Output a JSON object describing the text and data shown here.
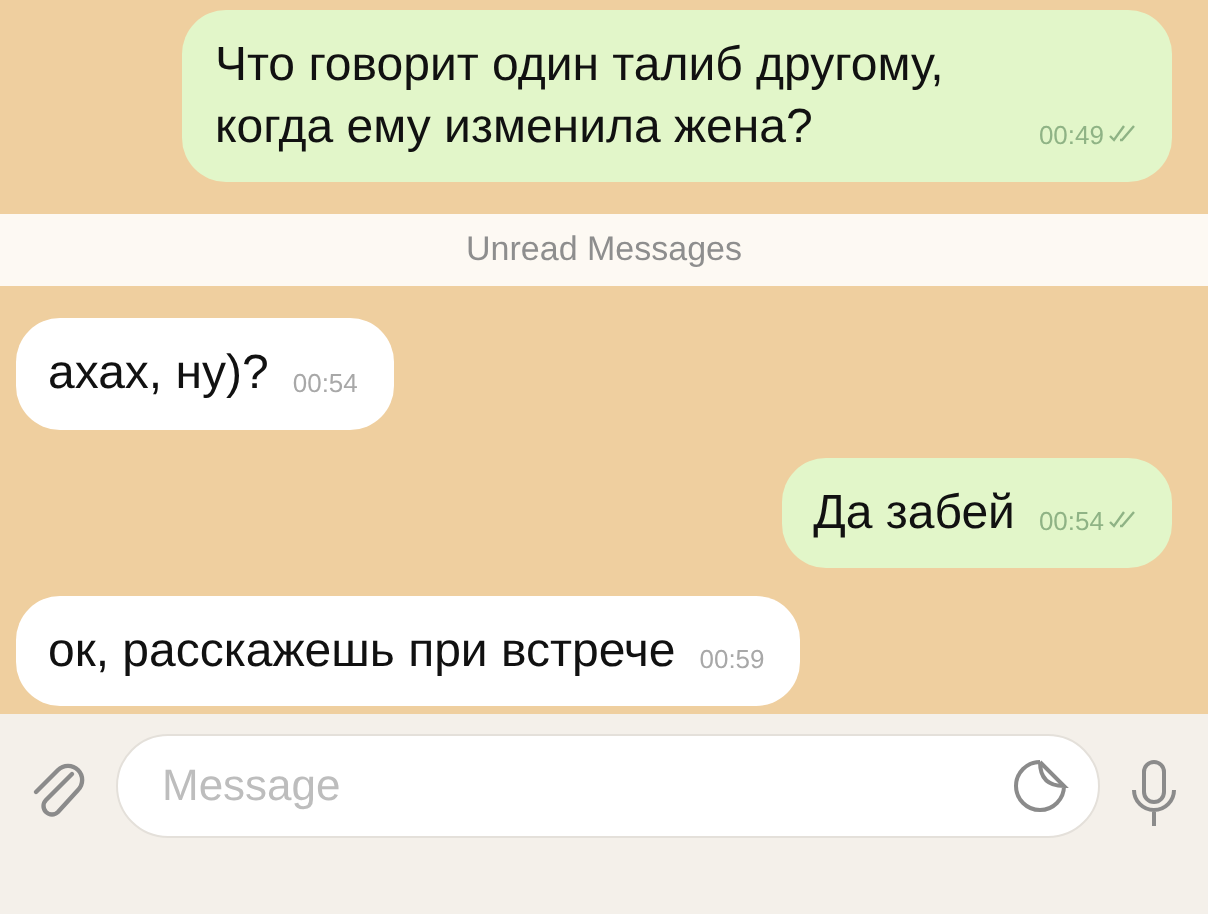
{
  "messages": [
    {
      "kind": "out",
      "text": "Что говорит один талиб другому, когда ему изменила жена?",
      "time": "00:49",
      "read": true
    },
    {
      "kind": "divider",
      "text": "Unread Messages"
    },
    {
      "kind": "in",
      "text": "ахах, ну)?",
      "time": "00:54"
    },
    {
      "kind": "out",
      "text": "Да забей",
      "time": "00:54",
      "read": true
    },
    {
      "kind": "in",
      "text": "ок, расскажешь при встрече",
      "time": "00:59"
    }
  ],
  "composer": {
    "placeholder": "Message"
  }
}
